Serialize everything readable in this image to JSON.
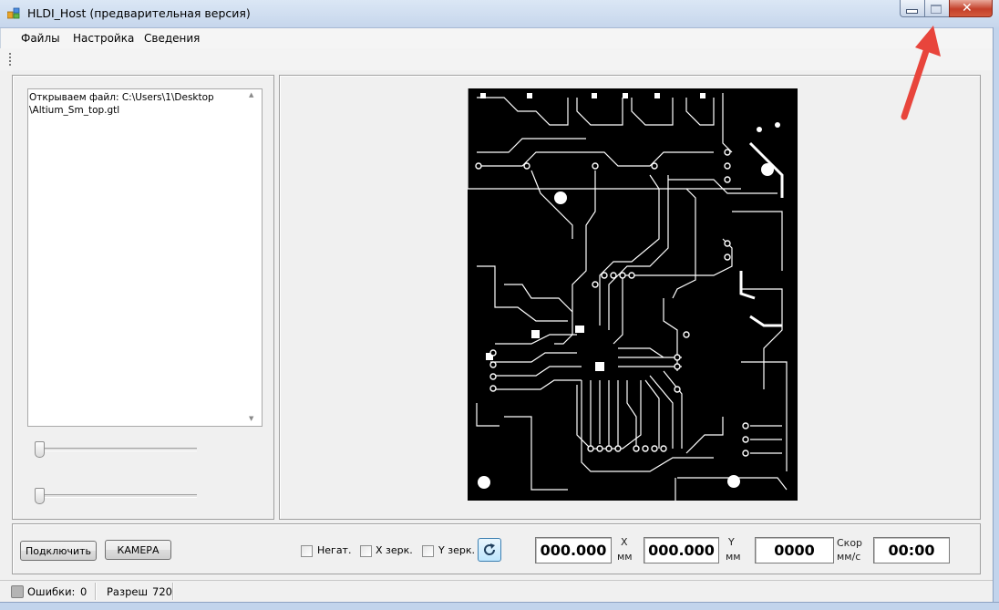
{
  "window": {
    "title": "HLDI_Host (предварительная версия)",
    "close_glyph": "✕"
  },
  "menu": {
    "items": [
      "Файлы",
      "Настройка",
      "Сведения"
    ]
  },
  "log": {
    "text": "Открываем файл: C:\\Users\\1\\Desktop\n\\Altium_Sm_top.gtl"
  },
  "sliders": {
    "slider1_value": 0,
    "slider2_value": 0
  },
  "controls": {
    "connect_label": "Подключить",
    "camera_label": "КАМЕРА",
    "negative_label": "Негат.",
    "x_mirror_label": "X зерк.",
    "y_mirror_label": "Y зерк.",
    "negative_checked": false,
    "x_mirror_checked": false,
    "y_mirror_checked": false
  },
  "readouts": {
    "x_value": "000.000",
    "x_axis": "X",
    "x_unit": "мм",
    "y_value": "000.000",
    "y_axis": "Y",
    "y_unit": "мм",
    "speed_value": "0000",
    "speed_label": "Скор",
    "speed_unit": "мм/с",
    "time_value": "00:00"
  },
  "status": {
    "errors_label": "Ошибки:",
    "errors_value": "0",
    "resolution_label": "Разреш",
    "resolution_value": "720"
  },
  "icons": {
    "app": "app-icon",
    "refresh": "refresh-icon",
    "annotation": "red-arrow-annotation"
  },
  "colors": {
    "annotation_arrow": "#e8453c",
    "close_button": "#c4402a",
    "refresh_accent": "#3c7fb1"
  }
}
